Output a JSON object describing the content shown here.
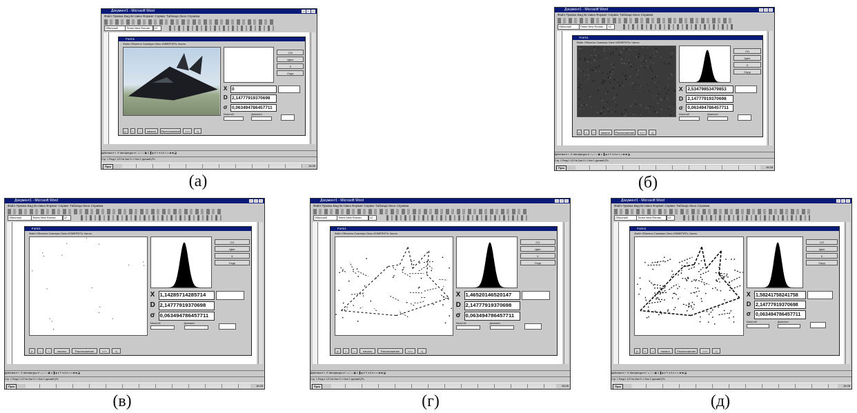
{
  "window": {
    "title": "Документ1 - Microsoft Word",
    "menu": "Файл  Правка  Вид  Вставка  Формат  Сервис  Таблица  Окно  Справка",
    "style_select": "Обычный",
    "font_select": "Times New Roman",
    "size_select": "12",
    "drawing_toolbar": "Действия ▾  ↖  ⟳  Автофигуры ▾  \\  ↘  □  ○  ▣  4  ▐  ◈ ▾  ✎ ▾  A ▾  ≡  ═  ⇄  ■  ◪",
    "status_bar": "Стр. 1   Разд 1   1/2   На 2см   Ст 1   Кол 1        русский (Ро",
    "start_label": "Пуск",
    "clock": "16:28"
  },
  "form": {
    "title": "Form1",
    "menu": "Файл   Объекты   Сканеры   Окно   ИЗМЕРИТЬ   Число",
    "side_buttons": [
      "CO",
      "Цвет",
      "X",
      "Серр"
    ],
    "labels": {
      "x": "X",
      "d": "D",
      "sigma": "σ",
      "scale": "Масштаб",
      "range": "Диапазон"
    },
    "bottom_buttons": [
      "|<",
      "<",
      ">",
      "начало",
      "Расположение",
      ">>>",
      ">|"
    ]
  },
  "panels": [
    {
      "id": "a",
      "caption": "(а)",
      "content": "aircraft",
      "hist": false,
      "x_value": "0",
      "d_value": "2,14777919370698",
      "sigma_value": "0,063494786457711"
    },
    {
      "id": "b",
      "caption": "(б)",
      "content": "noise",
      "hist": true,
      "x_value": "2,53479853479853",
      "d_value": "2,14777919370698",
      "sigma_value": "0,063494786457711"
    },
    {
      "id": "v",
      "caption": "(в)",
      "content": "blank",
      "hist": true,
      "x_value": "1,14285714285714",
      "d_value": "2,14777919370698",
      "sigma_value": "0,063494786457711"
    },
    {
      "id": "g",
      "caption": "(г)",
      "content": "edges-light",
      "hist": true,
      "x_value": "1,46520146520147",
      "d_value": "2,14777919370698",
      "sigma_value": "0,063494786457711"
    },
    {
      "id": "d",
      "caption": "(д)",
      "content": "edges-dense",
      "hist": true,
      "x_value": "1,58241758241758",
      "d_value": "2,14777919370698",
      "sigma_value": "0,063494786457711"
    }
  ],
  "colors": {
    "titlebar": "#0a1a78",
    "chrome": "#c9c9c9",
    "histogram": "#000000"
  }
}
